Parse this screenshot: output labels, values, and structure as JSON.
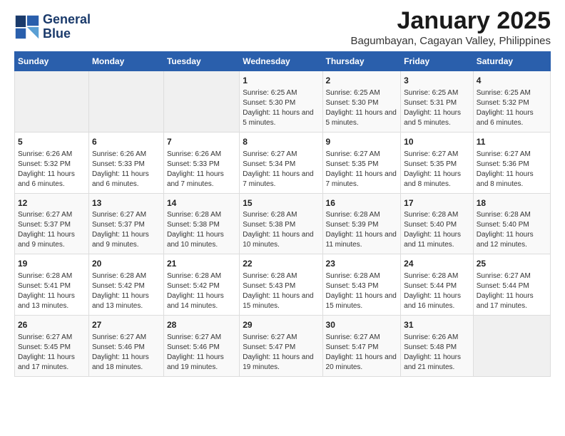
{
  "header": {
    "logo_line1": "General",
    "logo_line2": "Blue",
    "title": "January 2025",
    "subtitle": "Bagumbayan, Cagayan Valley, Philippines"
  },
  "days_of_week": [
    "Sunday",
    "Monday",
    "Tuesday",
    "Wednesday",
    "Thursday",
    "Friday",
    "Saturday"
  ],
  "weeks": [
    {
      "days": [
        {
          "num": "",
          "info": "",
          "empty": true
        },
        {
          "num": "",
          "info": "",
          "empty": true
        },
        {
          "num": "",
          "info": "",
          "empty": true
        },
        {
          "num": "1",
          "info": "Sunrise: 6:25 AM\nSunset: 5:30 PM\nDaylight: 11 hours and 5 minutes."
        },
        {
          "num": "2",
          "info": "Sunrise: 6:25 AM\nSunset: 5:30 PM\nDaylight: 11 hours and 5 minutes."
        },
        {
          "num": "3",
          "info": "Sunrise: 6:25 AM\nSunset: 5:31 PM\nDaylight: 11 hours and 5 minutes."
        },
        {
          "num": "4",
          "info": "Sunrise: 6:25 AM\nSunset: 5:32 PM\nDaylight: 11 hours and 6 minutes."
        }
      ]
    },
    {
      "days": [
        {
          "num": "5",
          "info": "Sunrise: 6:26 AM\nSunset: 5:32 PM\nDaylight: 11 hours and 6 minutes."
        },
        {
          "num": "6",
          "info": "Sunrise: 6:26 AM\nSunset: 5:33 PM\nDaylight: 11 hours and 6 minutes."
        },
        {
          "num": "7",
          "info": "Sunrise: 6:26 AM\nSunset: 5:33 PM\nDaylight: 11 hours and 7 minutes."
        },
        {
          "num": "8",
          "info": "Sunrise: 6:27 AM\nSunset: 5:34 PM\nDaylight: 11 hours and 7 minutes."
        },
        {
          "num": "9",
          "info": "Sunrise: 6:27 AM\nSunset: 5:35 PM\nDaylight: 11 hours and 7 minutes."
        },
        {
          "num": "10",
          "info": "Sunrise: 6:27 AM\nSunset: 5:35 PM\nDaylight: 11 hours and 8 minutes."
        },
        {
          "num": "11",
          "info": "Sunrise: 6:27 AM\nSunset: 5:36 PM\nDaylight: 11 hours and 8 minutes."
        }
      ]
    },
    {
      "days": [
        {
          "num": "12",
          "info": "Sunrise: 6:27 AM\nSunset: 5:37 PM\nDaylight: 11 hours and 9 minutes."
        },
        {
          "num": "13",
          "info": "Sunrise: 6:27 AM\nSunset: 5:37 PM\nDaylight: 11 hours and 9 minutes."
        },
        {
          "num": "14",
          "info": "Sunrise: 6:28 AM\nSunset: 5:38 PM\nDaylight: 11 hours and 10 minutes."
        },
        {
          "num": "15",
          "info": "Sunrise: 6:28 AM\nSunset: 5:38 PM\nDaylight: 11 hours and 10 minutes."
        },
        {
          "num": "16",
          "info": "Sunrise: 6:28 AM\nSunset: 5:39 PM\nDaylight: 11 hours and 11 minutes."
        },
        {
          "num": "17",
          "info": "Sunrise: 6:28 AM\nSunset: 5:40 PM\nDaylight: 11 hours and 11 minutes."
        },
        {
          "num": "18",
          "info": "Sunrise: 6:28 AM\nSunset: 5:40 PM\nDaylight: 11 hours and 12 minutes."
        }
      ]
    },
    {
      "days": [
        {
          "num": "19",
          "info": "Sunrise: 6:28 AM\nSunset: 5:41 PM\nDaylight: 11 hours and 13 minutes."
        },
        {
          "num": "20",
          "info": "Sunrise: 6:28 AM\nSunset: 5:42 PM\nDaylight: 11 hours and 13 minutes."
        },
        {
          "num": "21",
          "info": "Sunrise: 6:28 AM\nSunset: 5:42 PM\nDaylight: 11 hours and 14 minutes."
        },
        {
          "num": "22",
          "info": "Sunrise: 6:28 AM\nSunset: 5:43 PM\nDaylight: 11 hours and 15 minutes."
        },
        {
          "num": "23",
          "info": "Sunrise: 6:28 AM\nSunset: 5:43 PM\nDaylight: 11 hours and 15 minutes."
        },
        {
          "num": "24",
          "info": "Sunrise: 6:28 AM\nSunset: 5:44 PM\nDaylight: 11 hours and 16 minutes."
        },
        {
          "num": "25",
          "info": "Sunrise: 6:27 AM\nSunset: 5:44 PM\nDaylight: 11 hours and 17 minutes."
        }
      ]
    },
    {
      "days": [
        {
          "num": "26",
          "info": "Sunrise: 6:27 AM\nSunset: 5:45 PM\nDaylight: 11 hours and 17 minutes."
        },
        {
          "num": "27",
          "info": "Sunrise: 6:27 AM\nSunset: 5:46 PM\nDaylight: 11 hours and 18 minutes."
        },
        {
          "num": "28",
          "info": "Sunrise: 6:27 AM\nSunset: 5:46 PM\nDaylight: 11 hours and 19 minutes."
        },
        {
          "num": "29",
          "info": "Sunrise: 6:27 AM\nSunset: 5:47 PM\nDaylight: 11 hours and 19 minutes."
        },
        {
          "num": "30",
          "info": "Sunrise: 6:27 AM\nSunset: 5:47 PM\nDaylight: 11 hours and 20 minutes."
        },
        {
          "num": "31",
          "info": "Sunrise: 6:26 AM\nSunset: 5:48 PM\nDaylight: 11 hours and 21 minutes."
        },
        {
          "num": "",
          "info": "",
          "empty": true
        }
      ]
    }
  ]
}
